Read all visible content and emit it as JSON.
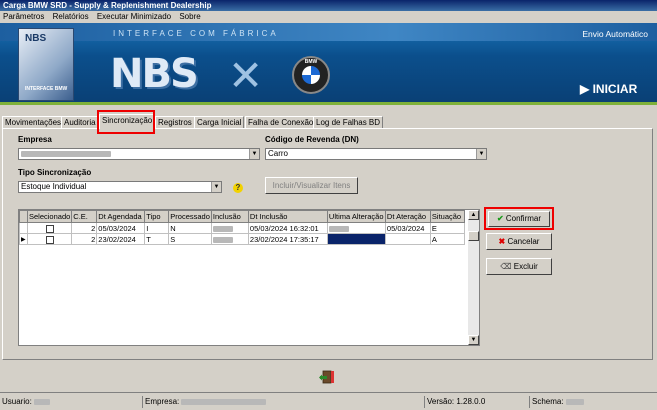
{
  "window": {
    "title": "Carga BMW SRD - Supply & Replenishment Dealership"
  },
  "menu": [
    "Parâmetros",
    "Relatórios",
    "Executar Minimizado",
    "Sobre"
  ],
  "banner": {
    "logo_title": "NBS",
    "logo_subtitle": "INTERFACE BMW",
    "interface_label": "INTERFACE COM FÁBRICA",
    "envio_label": "Envio Automático",
    "iniciar_label": "INICIAR",
    "nbs_text": "NBS",
    "bmw_text": "BMW"
  },
  "tabs": [
    {
      "label": "Movimentações"
    },
    {
      "label": "Auditoria"
    },
    {
      "label": "Sincronização",
      "active": true
    },
    {
      "label": "Registros"
    },
    {
      "label": "Carga Inicial"
    },
    {
      "label": "Falha de Conexão"
    },
    {
      "label": "Log de Falhas BD"
    }
  ],
  "form": {
    "empresa_label": "Empresa",
    "codigo_label": "Código de Revenda (DN)",
    "codigo_value": "Carro",
    "tipo_label": "Tipo Sincronização",
    "tipo_value": "Estoque Individual",
    "incluir_button": "Incluir/Visualizar Itens"
  },
  "grid": {
    "columns": [
      "",
      "Selecionado",
      "C.E.",
      "Dt Agendada",
      "Tipo",
      "Processado",
      "Inclusão",
      "Dt Inclusão",
      "Ultima Alteração",
      "Dt Ateração",
      "Situação"
    ],
    "rows": [
      {
        "ce": "2",
        "dt_agendada": "05/03/2024",
        "tipo": "I",
        "processado": "N",
        "dt_inclusao": "05/03/2024 16:32:01",
        "dt_alteracao": "05/03/2024",
        "situacao": "E"
      },
      {
        "ce": "2",
        "dt_agendada": "23/02/2024",
        "tipo": "T",
        "processado": "S",
        "dt_inclusao": "23/02/2024 17:35:17",
        "dt_alteracao": "",
        "situacao": "A"
      }
    ]
  },
  "buttons": {
    "confirmar": "Confirmar",
    "cancelar": "Cancelar",
    "excluir": "Excluir"
  },
  "status": {
    "usuario_label": "Usuario:",
    "empresa_label": "Empresa:",
    "versao_label": "Versão: 1.28.0.0",
    "schema_label": "Schema:"
  },
  "colors": {
    "accent_red": "#e00000",
    "banner_blue": "#0b4f8c",
    "selection": "#0a246a"
  }
}
